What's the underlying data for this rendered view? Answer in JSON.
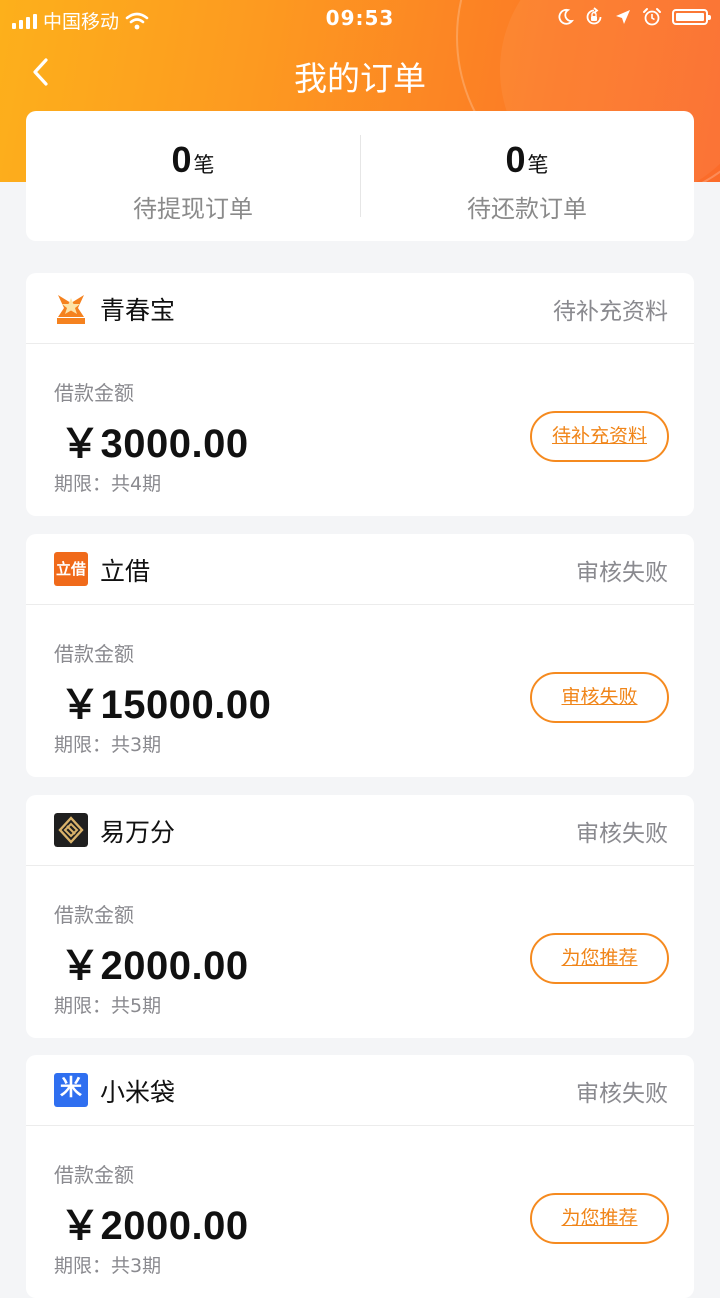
{
  "status_bar": {
    "carrier": "中国移动",
    "time": "09:53"
  },
  "nav": {
    "title": "我的订单"
  },
  "summary": [
    {
      "count": "0",
      "unit": "笔",
      "label": "待提现订单"
    },
    {
      "count": "0",
      "unit": "笔",
      "label": "待还款订单"
    }
  ],
  "orders": [
    {
      "brand": "青春宝",
      "status": "待补充资料",
      "amount_label": "借款金额",
      "amount": "￥3000.00",
      "term": "期限：共4期",
      "action": "待补充资料",
      "logo_text": ""
    },
    {
      "brand": "立借",
      "status": "审核失败",
      "amount_label": "借款金额",
      "amount": "￥15000.00",
      "term": "期限：共3期",
      "action": "审核失败",
      "logo_text": "立借"
    },
    {
      "brand": "易万分",
      "status": "审核失败",
      "amount_label": "借款金额",
      "amount": "￥2000.00",
      "term": "期限：共5期",
      "action": "为您推荐",
      "logo_text": ""
    },
    {
      "brand": "小米袋",
      "status": "审核失败",
      "amount_label": "借款金额",
      "amount": "￥2000.00",
      "term": "期限：共3期",
      "action": "为您推荐",
      "logo_text": "米"
    }
  ],
  "colors": {
    "accent": "#f58a1f",
    "header_start": "#fdb01b",
    "header_end": "#fb6b2a",
    "muted": "#8a8a8f"
  },
  "icons": {
    "back": "chevron-left-icon",
    "wifi": "wifi-icon",
    "moon": "moon-icon",
    "lock": "rotation-lock-icon",
    "location": "location-arrow-icon",
    "alarm": "alarm-icon",
    "battery": "battery-icon"
  }
}
